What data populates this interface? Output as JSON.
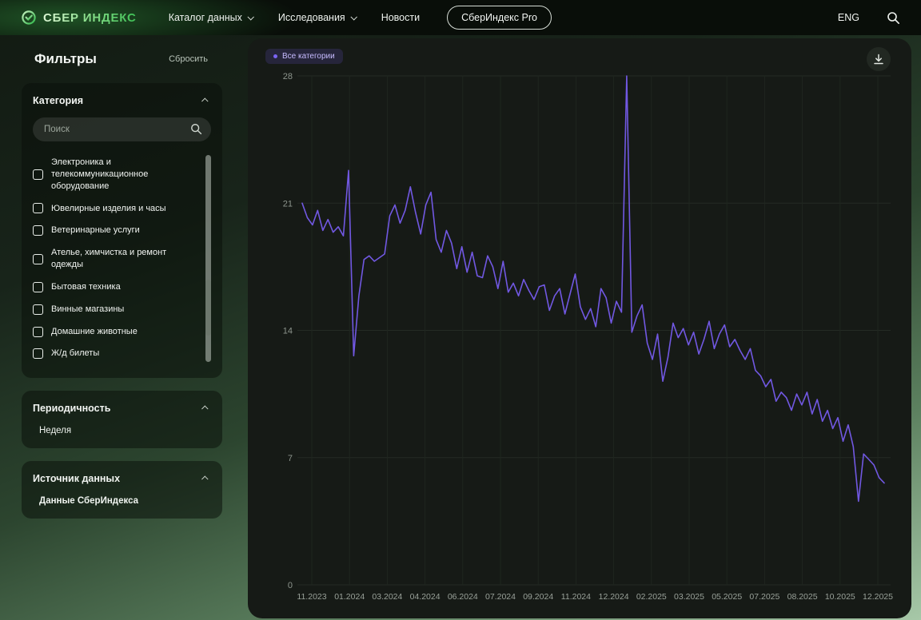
{
  "header": {
    "logo": "СБЕР ИНДЕКС",
    "nav": [
      {
        "label": "Каталог данных",
        "chevron": true
      },
      {
        "label": "Исследования",
        "chevron": true
      },
      {
        "label": "Новости",
        "chevron": false
      }
    ],
    "pro_button": "СберИндекс Pro",
    "lang": "ENG"
  },
  "sidebar": {
    "title": "Фильтры",
    "reset": "Сбросить",
    "category": {
      "title": "Категория",
      "search_placeholder": "Поиск",
      "items": [
        "Электроника и телекоммуникационное оборудование",
        "Ювелирные изделия и часы",
        "Ветеринарные услуги",
        "Ателье, химчистка и ремонт одежды",
        "Бытовая техника",
        "Винные магазины",
        "Домашние животные",
        "Ж/д билеты"
      ]
    },
    "periodicity": {
      "title": "Периодичность",
      "value": "Неделя"
    },
    "source": {
      "title": "Источник данных",
      "value": "Данные СберИндекса"
    }
  },
  "chart": {
    "legend": "Все категории"
  },
  "icons": {
    "logo": "sber-ring-check-icon",
    "nav_chevron": "chevron-down-icon",
    "header_search": "search-icon",
    "sidebar_search": "search-icon",
    "card_chevron": "chevron-up-icon",
    "download": "download-icon",
    "legend_dot": "series-dot"
  },
  "colors": {
    "accent_line": "#7158e2",
    "legend_bg": "rgba(113,88,226,0.18)",
    "panel_bg": "#161a16",
    "brand_green": "#3ec155"
  },
  "chart_data": {
    "type": "line",
    "title": "",
    "xlabel": "",
    "ylabel": "",
    "ylim": [
      0,
      28
    ],
    "yticks": [
      0,
      7,
      14,
      21,
      28
    ],
    "grid": true,
    "legend_position": "top-left",
    "x_tick_labels": [
      "11.2023",
      "01.2024",
      "03.2024",
      "04.2024",
      "06.2024",
      "07.2024",
      "09.2024",
      "11.2024",
      "12.2024",
      "02.2025",
      "03.2025",
      "05.2025",
      "07.2025",
      "08.2025",
      "10.2025",
      "12.2025"
    ],
    "x_unit": "week",
    "series": [
      {
        "name": "Все категории",
        "color": "#7158e2",
        "values": [
          21.0,
          20.2,
          19.8,
          20.6,
          19.5,
          20.1,
          19.4,
          19.7,
          19.2,
          22.8,
          12.6,
          15.9,
          17.9,
          18.1,
          17.8,
          18.0,
          18.2,
          20.3,
          20.9,
          19.9,
          20.6,
          21.9,
          20.5,
          19.3,
          20.9,
          21.6,
          19.0,
          18.3,
          19.5,
          18.8,
          17.4,
          18.6,
          17.2,
          18.3,
          17.0,
          16.9,
          18.1,
          17.5,
          16.3,
          17.8,
          16.1,
          16.6,
          15.9,
          16.8,
          16.2,
          15.7,
          16.4,
          16.5,
          15.1,
          15.9,
          16.3,
          14.9,
          16.0,
          17.1,
          15.3,
          14.6,
          15.2,
          14.2,
          16.3,
          15.8,
          14.4,
          15.6,
          15.0,
          28.0,
          13.9,
          14.8,
          15.4,
          13.3,
          12.4,
          13.8,
          11.2,
          12.5,
          14.4,
          13.6,
          14.1,
          13.2,
          13.9,
          12.7,
          13.5,
          14.5,
          13.0,
          13.8,
          14.3,
          13.1,
          13.5,
          12.9,
          12.4,
          13.0,
          11.8,
          11.5,
          10.9,
          11.3,
          10.1,
          10.6,
          10.3,
          9.6,
          10.5,
          9.9,
          10.6,
          9.4,
          10.2,
          9.0,
          9.6,
          8.6,
          9.2,
          7.9,
          8.8,
          7.6,
          4.6,
          7.2,
          6.9,
          6.6,
          5.9,
          5.6
        ]
      }
    ]
  }
}
